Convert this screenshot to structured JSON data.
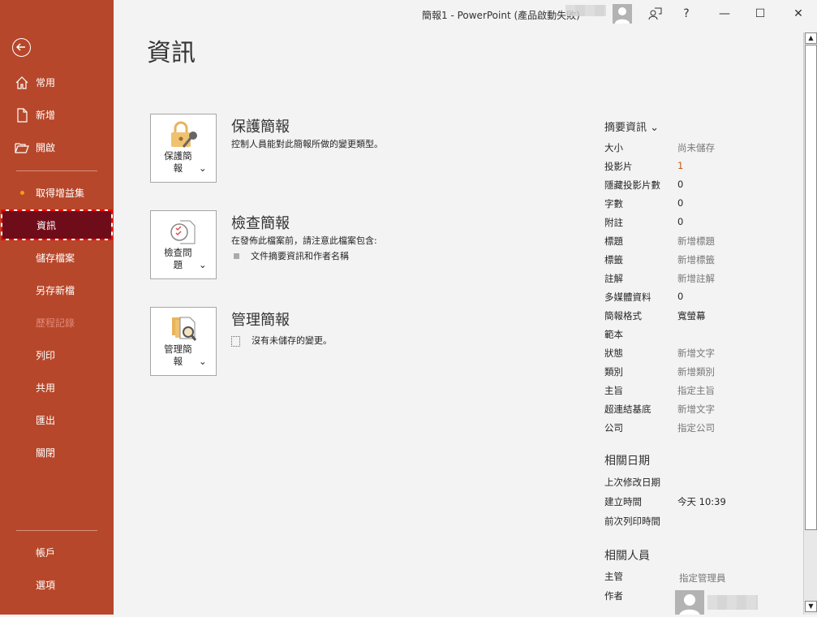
{
  "window": {
    "title": "簡報1  -  PowerPoint (產品啟動失敗)",
    "help": "?",
    "minimize": "—",
    "maximize": "☐",
    "close": "✕"
  },
  "sidebar": {
    "items": [
      {
        "label": "常用",
        "icon": "home-icon"
      },
      {
        "label": "新增",
        "icon": "new-document-icon"
      },
      {
        "label": "開啟",
        "icon": "folder-open-icon"
      },
      {
        "label": "取得增益集",
        "icon": "dot-icon"
      },
      {
        "label": "資訊",
        "selected": true
      },
      {
        "label": "儲存檔案"
      },
      {
        "label": "另存新檔"
      },
      {
        "label": "歷程記錄",
        "disabled": true
      },
      {
        "label": "列印"
      },
      {
        "label": "共用"
      },
      {
        "label": "匯出"
      },
      {
        "label": "關閉"
      },
      {
        "label": "帳戶"
      },
      {
        "label": "選項"
      }
    ],
    "accent": "#B7472A",
    "selected_bg": "#6F0C19"
  },
  "main": {
    "title": "資訊",
    "sections": [
      {
        "button": "保護簡報",
        "chev": "⌄",
        "heading": "保護簡報",
        "desc": "控制人員能對此簡報所做的變更類型。"
      },
      {
        "button": "檢查問題",
        "chev": "⌄",
        "heading": "檢查簡報",
        "desc": "在發佈此檔案前，請注意此檔案包含:",
        "bullet": "文件摘要資訊和作者名稱"
      },
      {
        "button": "管理簡報",
        "chev": "⌄",
        "heading": "管理簡報",
        "desc": "沒有未儲存的變更。"
      }
    ]
  },
  "properties": {
    "heading": "摘要資訊 ⌄",
    "rows": [
      {
        "label": "大小",
        "value": "尚未儲存"
      },
      {
        "label": "投影片",
        "value": "1"
      },
      {
        "label": "隱藏投影片數",
        "value": "0"
      },
      {
        "label": "字數",
        "value": "0"
      },
      {
        "label": "附註",
        "value": "0"
      },
      {
        "label": "標題",
        "value": "新增標題"
      },
      {
        "label": "標籤",
        "value": "新增標籤"
      },
      {
        "label": "註解",
        "value": "新增註解"
      },
      {
        "label": "多媒體資料",
        "value": "0"
      },
      {
        "label": "簡報格式",
        "value": "寬螢幕"
      },
      {
        "label": "範本",
        "value": ""
      },
      {
        "label": "狀態",
        "value": "新增文字"
      },
      {
        "label": "類別",
        "value": "新增類別"
      },
      {
        "label": "主旨",
        "value": "指定主旨"
      },
      {
        "label": "超連結基底",
        "value": "新增文字"
      },
      {
        "label": "公司",
        "value": "指定公司"
      }
    ],
    "dates_heading": "相關日期",
    "dates": [
      {
        "label": "上次修改日期",
        "value": ""
      },
      {
        "label": "建立時間",
        "value": "今天 10:39"
      },
      {
        "label": "前次列印時間",
        "value": ""
      }
    ],
    "people_heading": "相關人員",
    "people": [
      {
        "label": "主管",
        "value": "指定管理員"
      },
      {
        "label": "作者",
        "value": ""
      }
    ]
  }
}
